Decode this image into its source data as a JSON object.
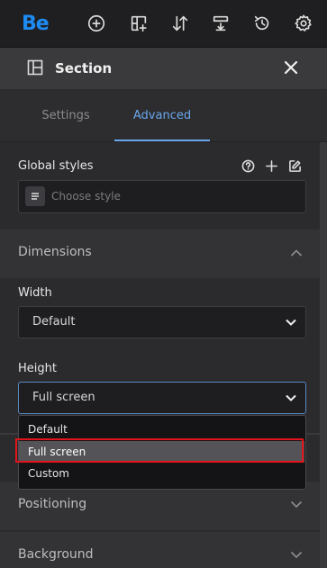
{
  "toolbar": {
    "logo": "Be",
    "icons": [
      "add-icon",
      "layout-add-icon",
      "sort-icon",
      "download-icon",
      "history-icon",
      "gear-icon"
    ]
  },
  "section": {
    "title": "Section"
  },
  "tabs": {
    "settings": "Settings",
    "advanced": "Advanced",
    "active": "Advanced"
  },
  "global_styles": {
    "label": "Global styles",
    "placeholder": "Choose style"
  },
  "dimensions": {
    "title": "Dimensions",
    "width_label": "Width",
    "width_value": "Default",
    "height_label": "Height",
    "height_value": "Full screen",
    "height_options": [
      "Default",
      "Full screen",
      "Custom"
    ],
    "highlighted_option": "Full screen"
  },
  "positioning": {
    "title": "Positioning"
  },
  "background": {
    "title": "Background"
  },
  "colors": {
    "accent": "#6aa6ec",
    "logo": "#1d8bf1",
    "highlight_border": "#e0141a"
  }
}
